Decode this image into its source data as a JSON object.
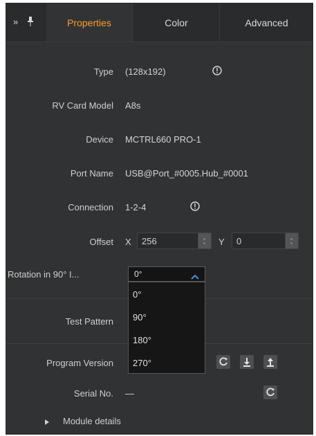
{
  "tabs": {
    "properties": "Properties",
    "color": "Color",
    "advanced": "Advanced"
  },
  "icons": {
    "expand": "double-chevron-right-icon",
    "pin": "pin-icon",
    "info": "info-icon",
    "refresh": "refresh-icon",
    "download": "download-icon",
    "upload": "upload-icon",
    "collapse_arrow": "triangle-right-icon",
    "select_arrow": "chevron-up-icon"
  },
  "colors": {
    "accent": "#ff9d2b",
    "panel": "#313234",
    "select_bg": "#141414",
    "dropdown_bg": "#161616"
  },
  "fields": {
    "type": {
      "label": "Type",
      "value": "(128x192)"
    },
    "rv_card_model": {
      "label": "RV Card Model",
      "value": "A8s"
    },
    "device": {
      "label": "Device",
      "value": "MCTRL660 PRO-1"
    },
    "port_name": {
      "label": "Port Name",
      "value": "USB@Port_#0005.Hub_#0001"
    },
    "connection": {
      "label": "Connection",
      "value": "1-2-4"
    },
    "offset": {
      "label": "Offset",
      "x_label": "X",
      "x_value": "256",
      "y_label": "Y",
      "y_value": "0"
    },
    "rotation": {
      "label": "Rotation in 90° I...",
      "selected": "0°",
      "options": [
        "0°",
        "90°",
        "180°",
        "270°"
      ]
    },
    "test_pattern": {
      "label": "Test Pattern"
    },
    "program_version": {
      "label": "Program Version"
    },
    "serial_no": {
      "label": "Serial No.",
      "value": "—"
    }
  },
  "module_details": "Module details"
}
